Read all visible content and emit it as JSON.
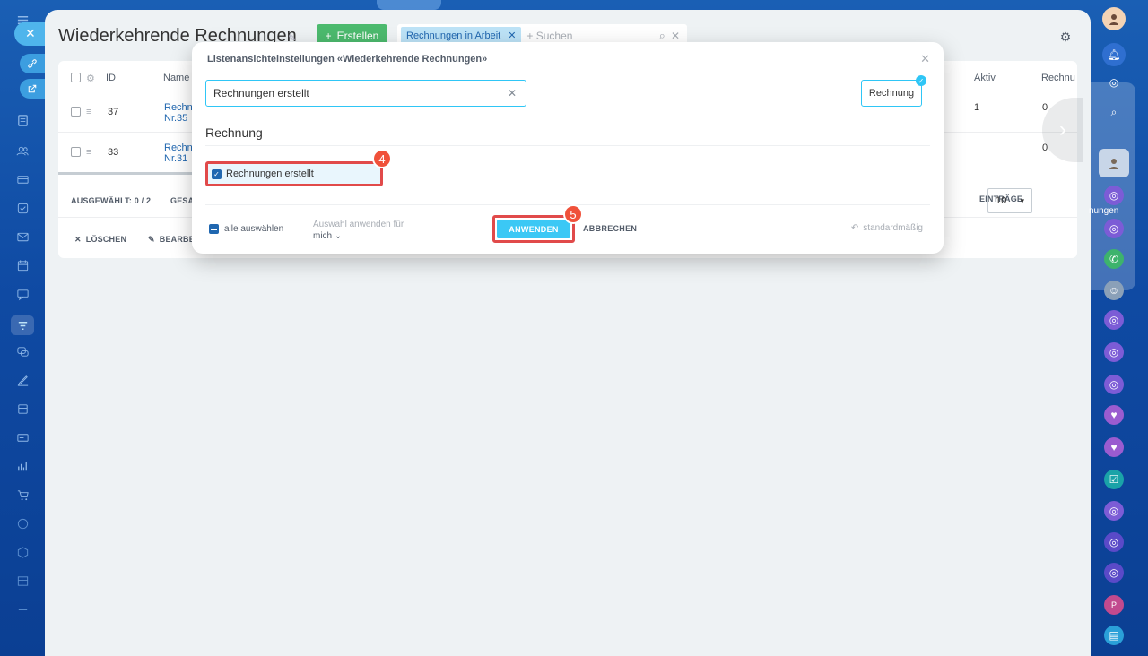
{
  "page": {
    "title": "Wiederkehrende Rechnungen",
    "create_label": "Erstellen",
    "filter_chip": "Rechnungen in Arbeit",
    "search_placeholder": "+ Suchen"
  },
  "grid": {
    "headers": {
      "id": "ID",
      "name": "Name",
      "aktiv": "Aktiv",
      "rechnung": "Rechnu"
    },
    "rows": [
      {
        "id": "37",
        "name_line1": "Rechn",
        "name_line2": "Nr.35",
        "aktiv": "1",
        "rechnung": "0"
      },
      {
        "id": "33",
        "name_line1": "Rechn",
        "name_line2": "Nr.31",
        "aktiv": "",
        "rechnung": "0"
      }
    ],
    "selected": "AUSGEWÄHLT: 0 / 2",
    "total_prefix": "GESA",
    "entries_label": "EINTRÄGE",
    "entries_value": "10",
    "delete_label": "LÖSCHEN",
    "edit_label": "BEARBE"
  },
  "modal": {
    "title": "Listenansichteinstellungen «Wiederkehrende Rechnungen»",
    "search_value": "Rechnungen erstellt",
    "tag_label": "Rechnung",
    "section_title": "Rechnung",
    "checkbox_label": "Rechnungen erstellt",
    "select_all": "alle auswählen",
    "apply_for_label": "Auswahl anwenden für",
    "apply_for_value": "mich",
    "apply_button": "ANWENDEN",
    "cancel_button": "ABBRECHEN",
    "default_button": "standardmäßig",
    "step4": "4",
    "step5": "5"
  },
  "rightbar": {
    "partial_label": "nungen"
  },
  "colors": {
    "accent": "#3bc8f5",
    "highlight": "#e14a4a",
    "link": "#2067b0",
    "create": "#4cba6e"
  }
}
